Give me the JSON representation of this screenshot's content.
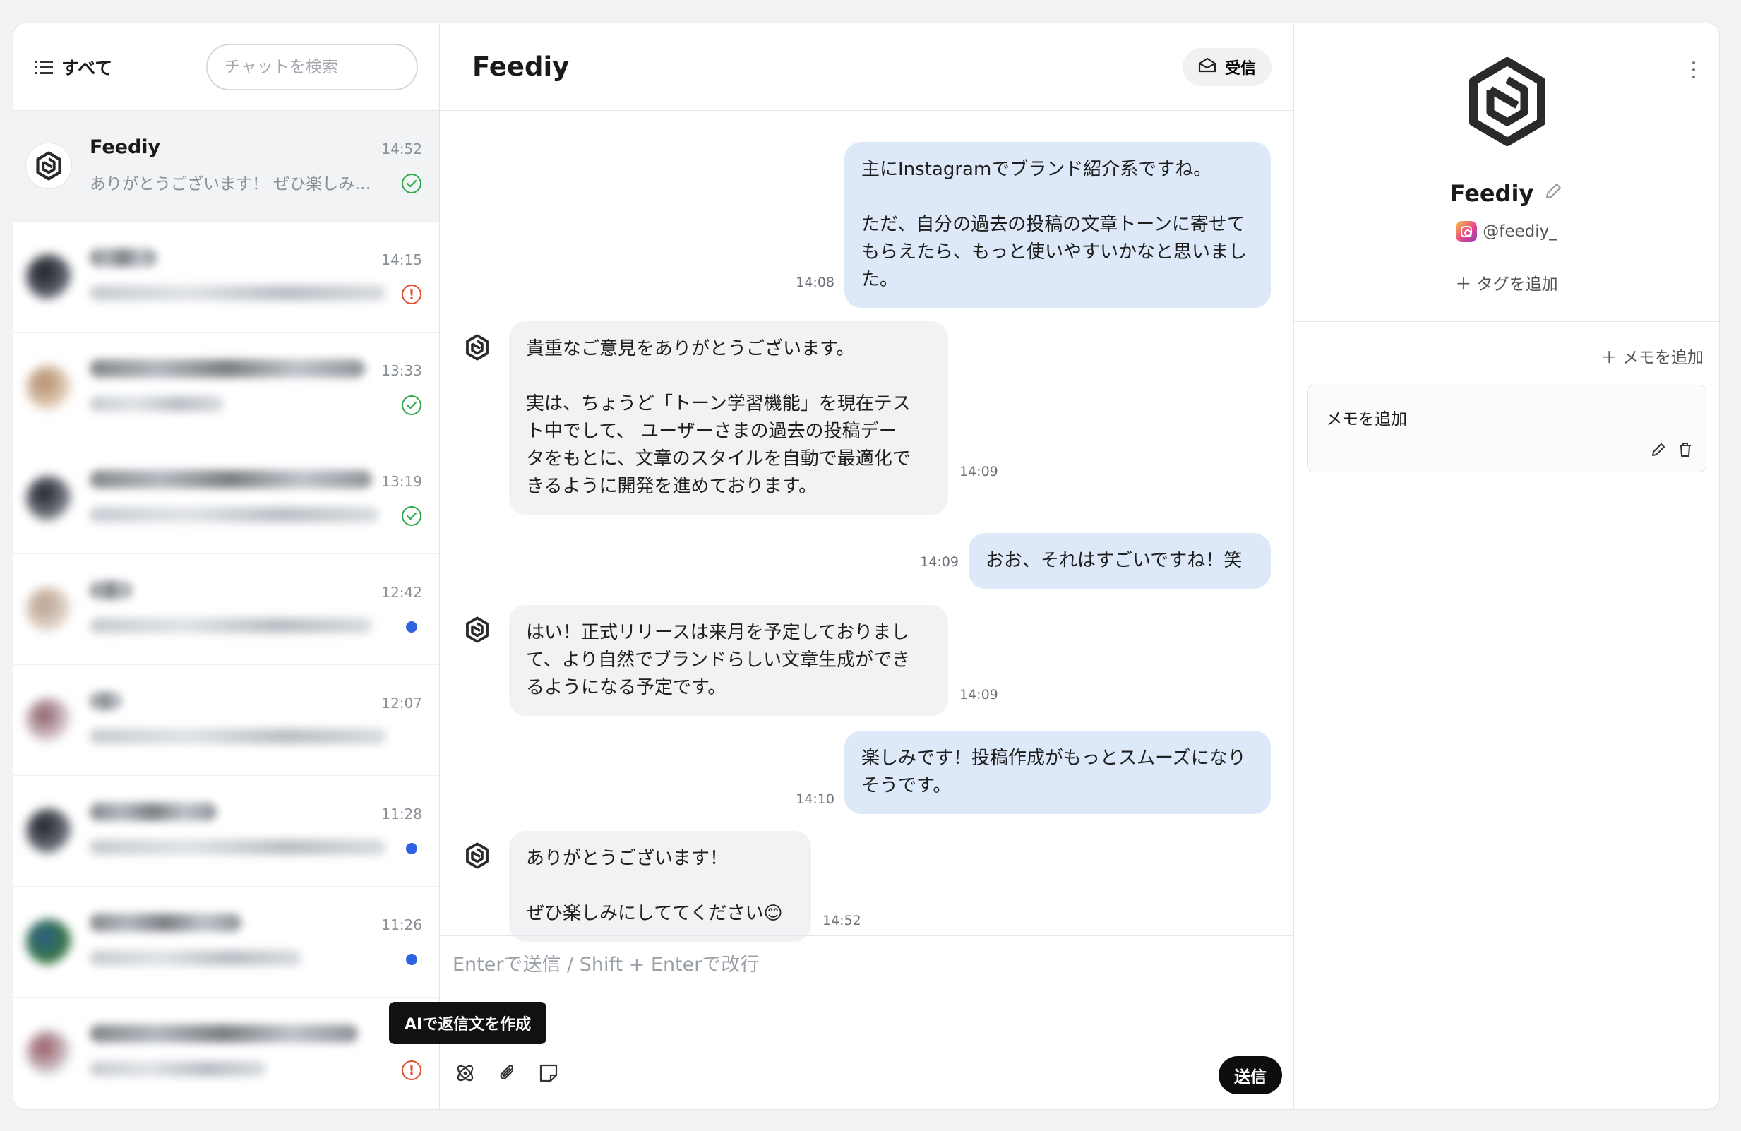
{
  "sidebar": {
    "filter_label": "すべて",
    "search_placeholder": "チャットを検索",
    "conversations": [
      {
        "name": "Feediy",
        "preview": "ありがとうございます！ ぜひ楽しみにしててください😊",
        "time": "14:52",
        "status": "replied"
      },
      {
        "name": "",
        "preview": "",
        "time": "14:15",
        "status": "alert"
      },
      {
        "name": "",
        "preview": "",
        "time": "13:33",
        "status": "replied"
      },
      {
        "name": "",
        "preview": "",
        "time": "13:19",
        "status": "replied"
      },
      {
        "name": "",
        "preview": "",
        "time": "12:42",
        "status": "unread"
      },
      {
        "name": "",
        "preview": "",
        "time": "12:07",
        "status": "none"
      },
      {
        "name": "",
        "preview": "",
        "time": "11:28",
        "status": "unread"
      },
      {
        "name": "",
        "preview": "",
        "time": "11:26",
        "status": "unread"
      },
      {
        "name": "",
        "preview": "",
        "time": "",
        "status": "alert"
      }
    ]
  },
  "tooltip": {
    "ai_reply": "AIで返信文を作成"
  },
  "chat": {
    "title": "Feediy",
    "inbox_label": "受信",
    "messages": [
      {
        "dir": "out",
        "text": "主にInstagramでブランド紹介系ですね。\n\nただ、自分の過去の投稿の文章トーンに寄せて\nもらえたら、もっと使いやすいかなと思いまし\nた。",
        "time": "14:08"
      },
      {
        "dir": "in",
        "text": "貴重なご意見をありがとうございます。\n\n実は、ちょうど「トーン学習機能」を現在テス\nト中でして、 ユーザーさまの過去の投稿デー\nタをもとに、文章のスタイルを自動で最適化で\nきるように開発を進めております。",
        "time": "14:09"
      },
      {
        "dir": "out",
        "text": "おお、それはすごいですね！笑",
        "time": "14:09"
      },
      {
        "dir": "in",
        "text": "はい！正式リリースは来月を予定しておりまし\nて、より自然でブランドらしい文章生成ができ\nるようになる予定です。",
        "time": "14:09"
      },
      {
        "dir": "out",
        "text": "楽しみです！投稿作成がもっとスムーズになり\nそうです。",
        "time": "14:10"
      },
      {
        "dir": "in",
        "text": "ありがとうございます！\n\nぜひ楽しみにしててください😊",
        "time": "14:52"
      }
    ],
    "composer_placeholder": "Enterで送信 / Shift + Enterで改行",
    "send_label": "送信",
    "tools": [
      "ai-reply-icon",
      "attach-icon",
      "note-icon"
    ]
  },
  "profile": {
    "name": "Feediy",
    "handle": "@feediy_",
    "add_tag_label": "＋ タグを追加",
    "add_memo_label": "＋ メモを追加",
    "memo_text": "メモを追加"
  },
  "colors": {
    "outgoing_bubble": "#dde8f8",
    "incoming_bubble": "#f1f2f4",
    "unread_dot": "#2f62e0",
    "replied_check": "#2ea84a",
    "alert": "#e0502e"
  }
}
